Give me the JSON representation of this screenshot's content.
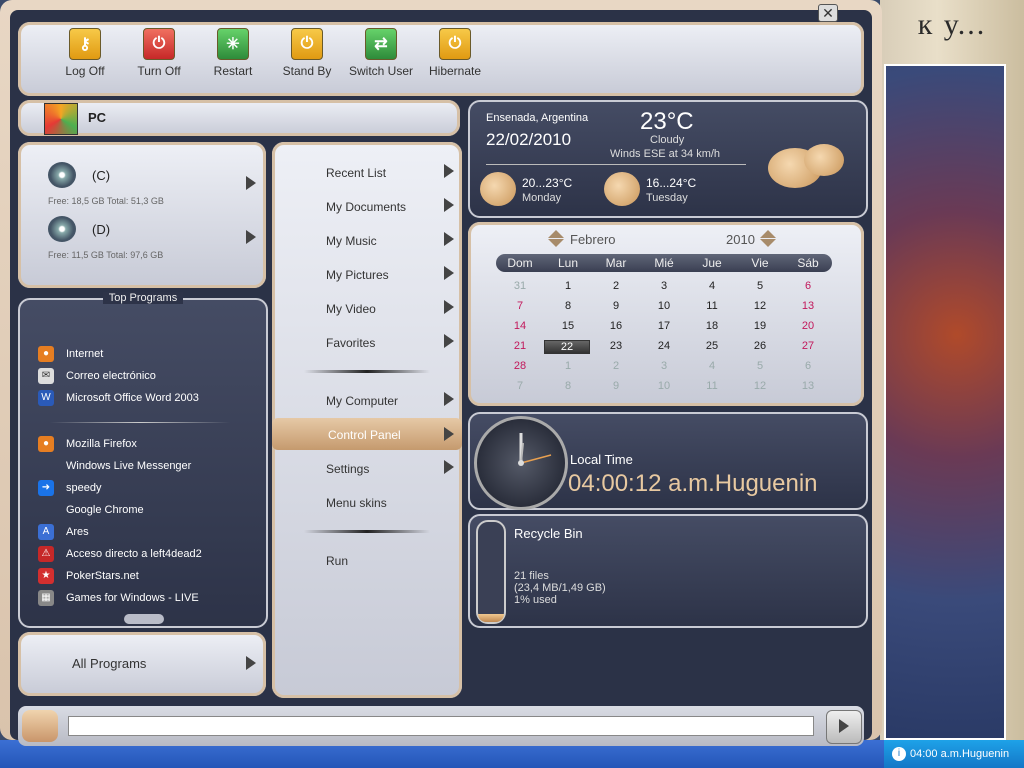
{
  "desktop": {
    "text": "к у..."
  },
  "taskbar": {
    "tray_time": "04:00 a.m.Huguenin"
  },
  "power": {
    "logoff": "Log Off",
    "turnoff": "Turn Off",
    "restart": "Restart",
    "standby": "Stand By",
    "switchuser": "Switch User",
    "hibernate": "Hibernate"
  },
  "user": {
    "name": "PC"
  },
  "drives": [
    {
      "letter": "(C)",
      "info": "Free: 18,5 GB Total: 51,3 GB"
    },
    {
      "letter": "(D)",
      "info": "Free: 11,5 GB Total: 97,6 GB"
    }
  ],
  "top_programs": {
    "title": "Top Programs",
    "pinned": [
      "Internet",
      "Correo electrónico",
      "Microsoft Office Word 2003"
    ],
    "recent": [
      "Mozilla Firefox",
      "Windows Live Messenger",
      "speedy",
      "Google Chrome",
      "Ares",
      "Acceso directo a left4dead2",
      "PokerStars.net",
      "Games for Windows - LIVE"
    ]
  },
  "all_programs": "All Programs",
  "links": {
    "recent_list": "Recent List",
    "documents": "My Documents",
    "music": "My Music",
    "pictures": "My Pictures",
    "video": "My Video",
    "favorites": "Favorites",
    "computer": "My Computer",
    "control_panel": "Control Panel",
    "settings": "Settings",
    "skins": "Menu skins",
    "run": "Run"
  },
  "weather": {
    "location": "Ensenada, Argentina",
    "date": "22/02/2010",
    "temp": "23°C",
    "condition": "Cloudy",
    "wind": "Winds ESE at 34 km/h",
    "forecast": [
      {
        "range": "20...23°C",
        "day": "Monday"
      },
      {
        "range": "16...24°C",
        "day": "Tuesday"
      }
    ]
  },
  "calendar": {
    "month": "Febrero",
    "year": "2010",
    "days": [
      "Dom",
      "Lun",
      "Mar",
      "Mié",
      "Jue",
      "Vie",
      "Sáb"
    ],
    "weeks": [
      [
        "31",
        "1",
        "2",
        "3",
        "4",
        "5",
        "6"
      ],
      [
        "7",
        "8",
        "9",
        "10",
        "11",
        "12",
        "13"
      ],
      [
        "14",
        "15",
        "16",
        "17",
        "18",
        "19",
        "20"
      ],
      [
        "21",
        "22",
        "23",
        "24",
        "25",
        "26",
        "27"
      ],
      [
        "28",
        "1",
        "2",
        "3",
        "4",
        "5",
        "6"
      ],
      [
        "7",
        "8",
        "9",
        "10",
        "11",
        "12",
        "13"
      ]
    ]
  },
  "clock": {
    "label": "Local Time",
    "time": "04:00:12 a.m.Huguenin"
  },
  "recycle": {
    "title": "Recycle Bin",
    "files": "21 files",
    "size": "(23,4 MB/1,49 GB)",
    "used": "1% used",
    "used_fraction": 0.01
  },
  "search": {
    "value": ""
  }
}
